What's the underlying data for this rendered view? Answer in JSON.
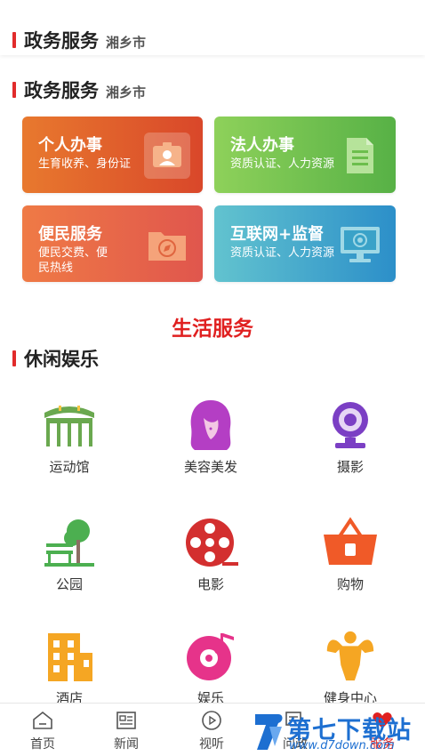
{
  "header": {
    "title": "政务服务",
    "city": "湘乡市"
  },
  "gov_section": {
    "title": "政务服务",
    "city": "湘乡市"
  },
  "cards": [
    {
      "title": "个人办事",
      "subtitle": "生育收养、身份证",
      "color": "#e0602a",
      "icon": "id-card-icon"
    },
    {
      "title": "法人办事",
      "subtitle": "资质认证、人力资源",
      "color": "#6cc24a",
      "icon": "document-icon"
    },
    {
      "title": "便民服务",
      "subtitle": "便民交费、便民热线",
      "color": "#e86a4a",
      "icon": "compass-folder-icon"
    },
    {
      "title": "互联网+监督",
      "subtitle": "资质认证、人力资源",
      "color": "#3aa6c9",
      "icon": "monitor-icon"
    }
  ],
  "life_title": "生活服务",
  "leisure_section": {
    "title": "休闲娱乐"
  },
  "leisure_items": [
    {
      "label": "运动馆",
      "icon": "stadium-icon",
      "color": "#6aa84f"
    },
    {
      "label": "美容美发",
      "icon": "hair-salon-icon",
      "color": "#b43ec4"
    },
    {
      "label": "摄影",
      "icon": "webcam-icon",
      "color": "#7b3fc4"
    },
    {
      "label": "公园",
      "icon": "park-icon",
      "color": "#4caf50"
    },
    {
      "label": "电影",
      "icon": "film-reel-icon",
      "color": "#d32f2f"
    },
    {
      "label": "购物",
      "icon": "shopping-basket-icon",
      "color": "#f05a28"
    },
    {
      "label": "酒店",
      "icon": "hotel-icon",
      "color": "#f5a623"
    },
    {
      "label": "娱乐",
      "icon": "music-disc-icon",
      "color": "#e6338a"
    },
    {
      "label": "健身中心",
      "icon": "fitness-icon",
      "color": "#f5a623"
    }
  ],
  "tabs": [
    {
      "label": "首页",
      "icon": "home-icon"
    },
    {
      "label": "新闻",
      "icon": "news-icon"
    },
    {
      "label": "视听",
      "icon": "play-icon"
    },
    {
      "label": "问政",
      "icon": "inquiry-icon"
    },
    {
      "label": "服务",
      "icon": "heart-icon",
      "active": true
    }
  ],
  "watermark": {
    "title": "第七下载站",
    "url": "www.d7down.com"
  }
}
